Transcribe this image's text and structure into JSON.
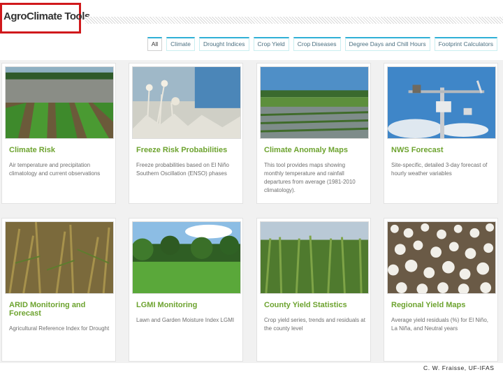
{
  "header": {
    "logo_text": "AgroClimate Tools"
  },
  "filters": [
    "All",
    "Climate",
    "Drought Indices",
    "Crop Yield",
    "Crop Diseases",
    "Degree Days and Chill Hours",
    "Footprint Calculators"
  ],
  "cards": [
    {
      "title": "Climate Risk",
      "description": "Air temperature and precipitation climatology and current observations",
      "image": "flooded-crop-field"
    },
    {
      "title": "Freeze Risk Probabilities",
      "description": "Freeze probabilities based on El Niño Southern Oscillation (ENSO) phases",
      "image": "frosted-plants"
    },
    {
      "title": "Climate Anomaly Maps",
      "description": "This tool provides maps showing monthly temperature and rainfall departures from average (1981-2010 climatology).",
      "image": "waterlogged-field"
    },
    {
      "title": "NWS Forecast",
      "description": "Site-specific, detailed 3-day forecast of hourly weather variables",
      "image": "weather-station"
    },
    {
      "title": "ARID Monitoring and Forecast",
      "description": "Agricultural Reference Index for Drought",
      "image": "drought-stressed-corn"
    },
    {
      "title": "LGMI Monitoring",
      "description": "Lawn and Garden Moisture Index LGMI",
      "image": "green-lawn-trees"
    },
    {
      "title": "County Yield Statistics",
      "description": "Crop yield series, trends and residuals at the county level",
      "image": "corn-field-rows"
    },
    {
      "title": "Regional Yield Maps",
      "description": "Average yield residuals (%) for El Niño, La Niña, and Neutral years",
      "image": "cotton-field"
    }
  ],
  "footer": {
    "credit": "C. W. Fraisse, UF-IFAS"
  },
  "colors": {
    "title_green": "#6da32f",
    "filter_accent": "#2fb0d6",
    "logo_border": "#d0191c"
  }
}
